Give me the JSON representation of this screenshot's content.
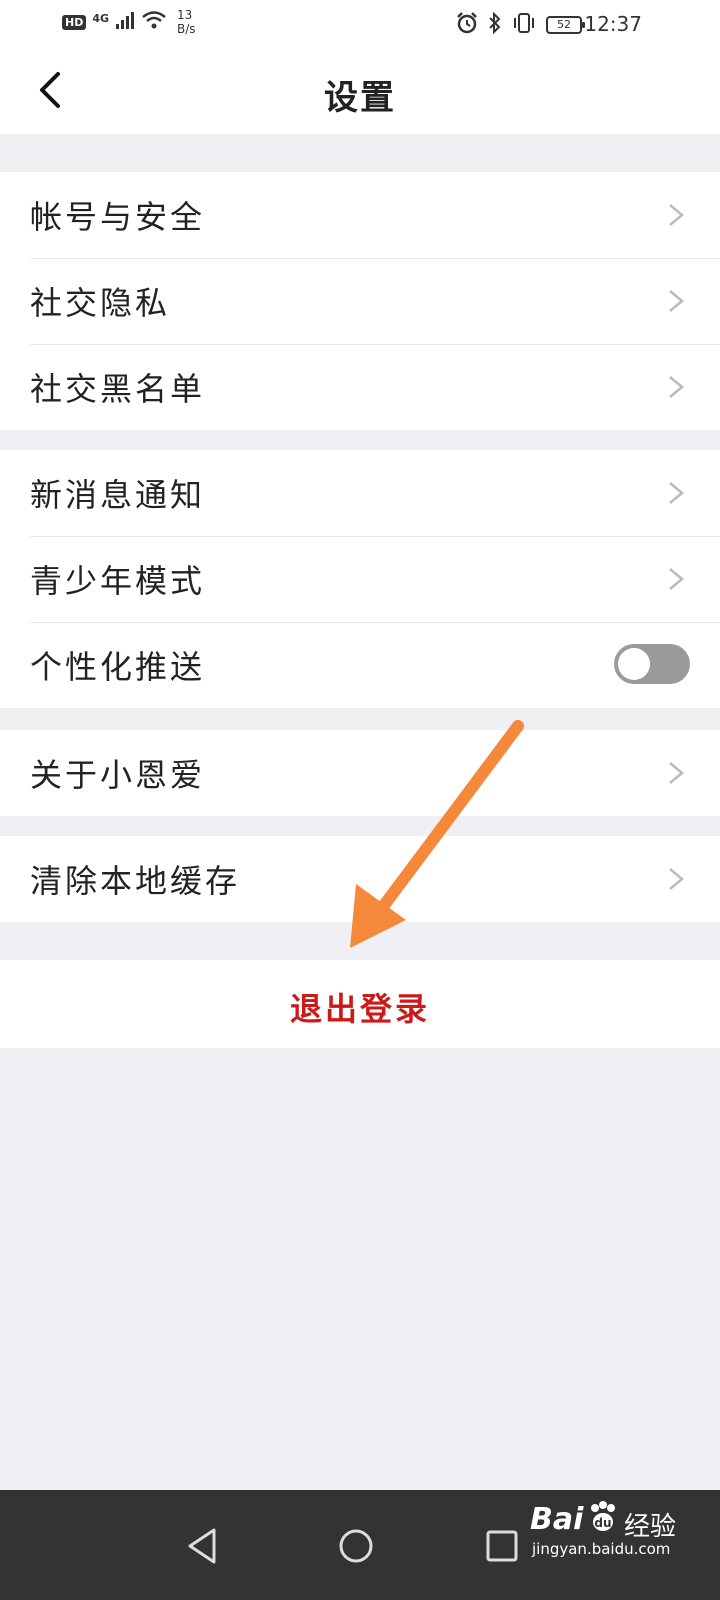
{
  "status_bar": {
    "hd": "HD",
    "network": "4G",
    "speed_value": "13",
    "speed_unit": "B/s",
    "battery": "52",
    "time": "12:37"
  },
  "header": {
    "title": "设置"
  },
  "groups": [
    {
      "items": [
        {
          "label": "帐号与安全",
          "type": "link"
        },
        {
          "label": "社交隐私",
          "type": "link"
        },
        {
          "label": "社交黑名单",
          "type": "link"
        }
      ]
    },
    {
      "items": [
        {
          "label": "新消息通知",
          "type": "link"
        },
        {
          "label": "青少年模式",
          "type": "link"
        },
        {
          "label": "个性化推送",
          "type": "toggle",
          "on": false
        }
      ]
    },
    {
      "items": [
        {
          "label": "关于小恩爱",
          "type": "link"
        }
      ]
    },
    {
      "items": [
        {
          "label": "清除本地缓存",
          "type": "link"
        }
      ]
    }
  ],
  "logout": {
    "label": "退出登录",
    "color": "#cc1a1a"
  },
  "annotation": {
    "arrow_color": "#f5883a"
  },
  "watermark": {
    "brand": "Bai",
    "sub": "经验",
    "url": "jingyan.baidu.com"
  },
  "colors": {
    "background": "#efeff4",
    "nav_bar": "#333333",
    "toggle_off": "#9a9a9a"
  }
}
